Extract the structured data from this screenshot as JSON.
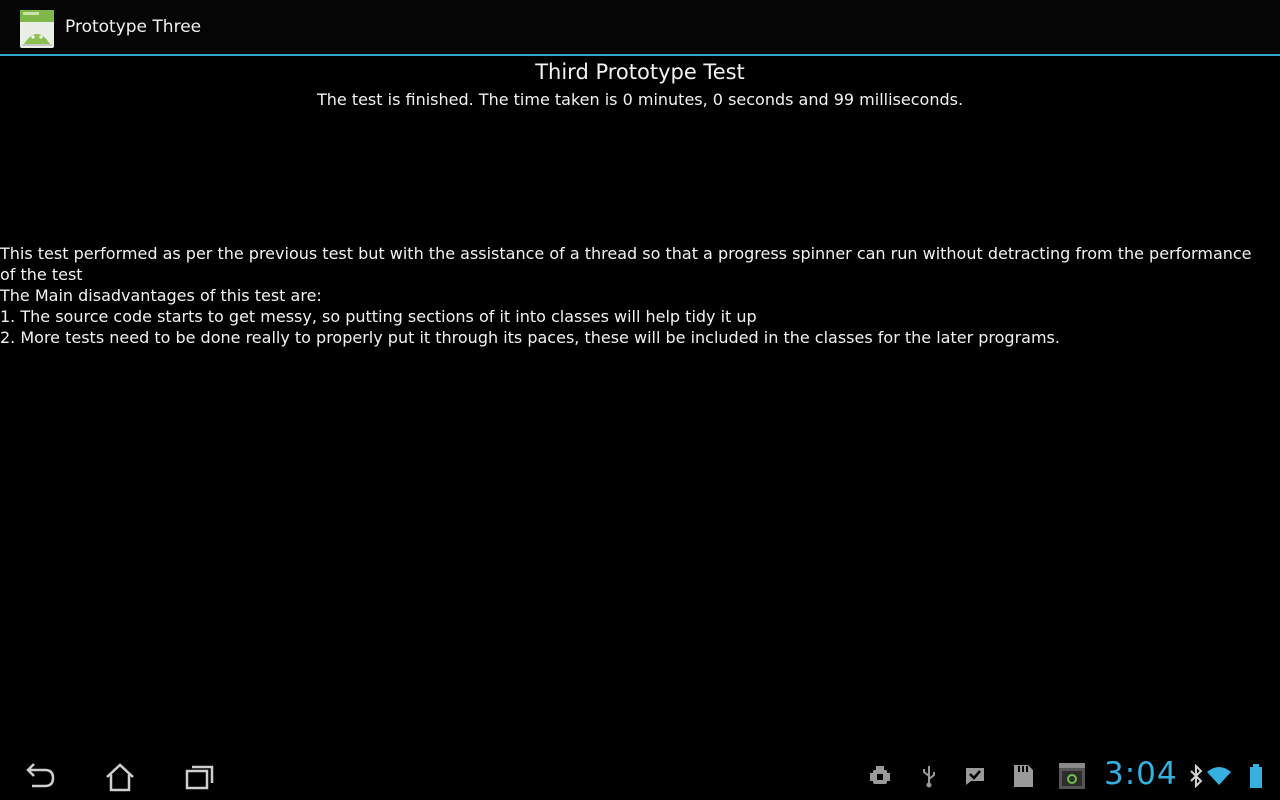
{
  "app": {
    "title": "Prototype Three",
    "icon": "android-app-icon",
    "accent_color": "#2fa4cf"
  },
  "content": {
    "title": "Third Prototype Test",
    "status": "The test is finished. The time taken is 0 minutes, 0 seconds and 99 milliseconds.",
    "lines": [
      " This test performed as per the previous test but with the assistance of a thread so that a progress spinner can run without detracting from the performance of the test",
      " The Main disadvantages of this test are:",
      " 1. The source code starts to get messy, so putting sections of it into classes will help tidy it up",
      " 2. More tests need to be done really to properly put it through its paces, these will be included in the classes for the later programs."
    ]
  },
  "system_bar": {
    "nav": [
      "back-icon",
      "home-icon",
      "recent-apps-icon"
    ],
    "status_icons": [
      "android-debug-icon",
      "usb-icon",
      "check-notification-icon",
      "sd-card-icon",
      "screenshot-icon",
      "bluetooth-icon",
      "wifi-icon",
      "battery-icon"
    ],
    "clock": "3:04",
    "clock_color": "#35b0e0"
  }
}
